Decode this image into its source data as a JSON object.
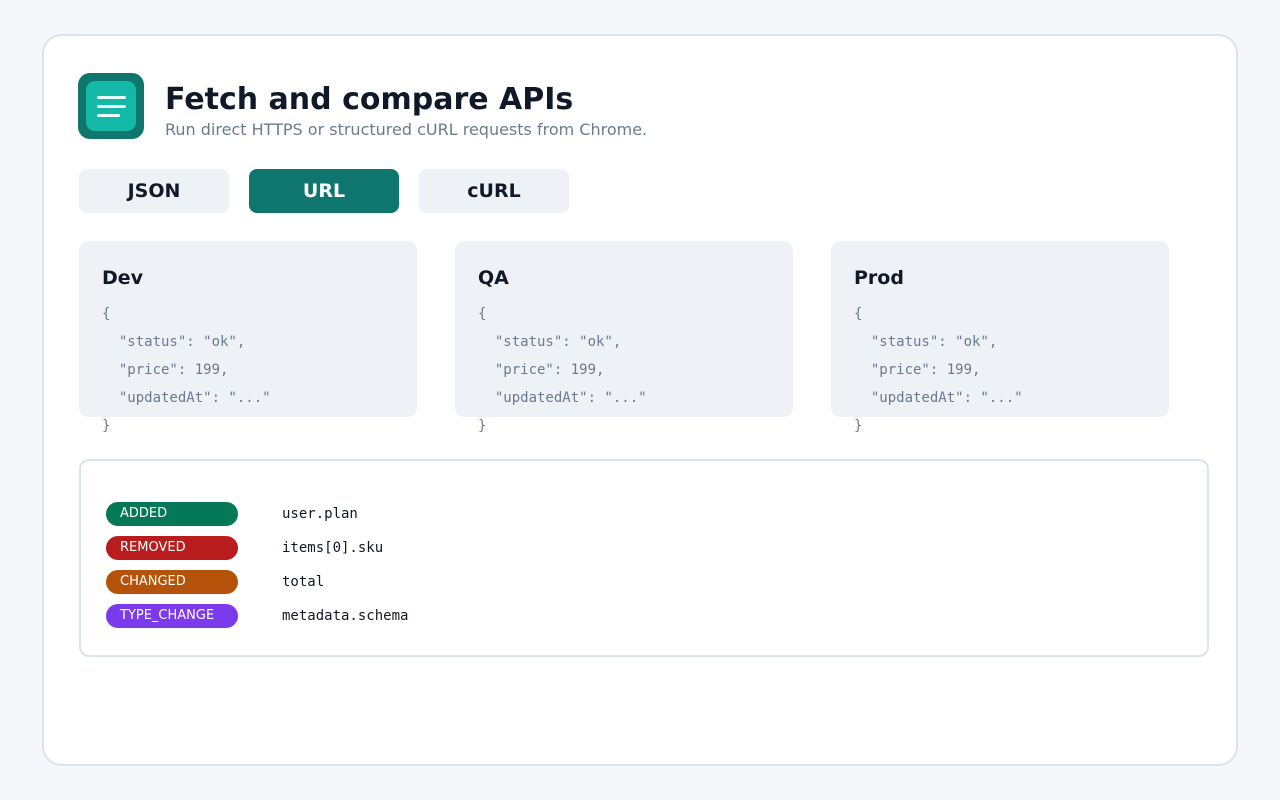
{
  "header": {
    "icon": "menu-icon",
    "title": "Fetch and compare APIs",
    "subtitle": "Run direct HTTPS or structured cURL requests from Chrome."
  },
  "tabs": [
    {
      "label": "JSON",
      "active": false
    },
    {
      "label": "URL",
      "active": true
    },
    {
      "label": "cURL",
      "active": false
    }
  ],
  "environments": [
    {
      "name": "Dev",
      "lines": [
        "{",
        "  \"status\": \"ok\",",
        "  \"price\": 199,",
        "  \"updatedAt\": \"...\"",
        "}"
      ]
    },
    {
      "name": "QA",
      "lines": [
        "{",
        "  \"status\": \"ok\",",
        "  \"price\": 199,",
        "  \"updatedAt\": \"...\"",
        "}"
      ]
    },
    {
      "name": "Prod",
      "lines": [
        "{",
        "  \"status\": \"ok\",",
        "  \"price\": 199,",
        "  \"updatedAt\": \"...\"",
        "}"
      ]
    }
  ],
  "diff": [
    {
      "kind": "ADDED",
      "path": "user.plan",
      "color": "#047857"
    },
    {
      "kind": "REMOVED",
      "path": "items[0].sku",
      "color": "#b91c1c"
    },
    {
      "kind": "CHANGED",
      "path": "total",
      "color": "#b45309"
    },
    {
      "kind": "TYPE_CHANGE",
      "path": "metadata.schema",
      "color": "#7c3aed"
    }
  ],
  "colors": {
    "accent": "#0f766e",
    "accent_light": "#14b8a6",
    "card_bg": "#eef1f5"
  }
}
